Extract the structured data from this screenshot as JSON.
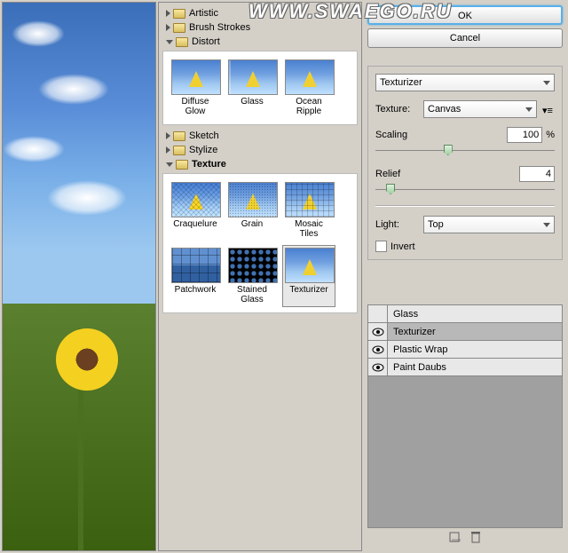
{
  "watermark": "WWW.SWAEGO.RU",
  "buttons": {
    "ok": "OK",
    "cancel": "Cancel"
  },
  "filter_select": "Texturizer",
  "categories": [
    {
      "name": "Artistic",
      "open": false
    },
    {
      "name": "Brush Strokes",
      "open": false
    },
    {
      "name": "Distort",
      "open": true,
      "items": [
        "Diffuse Glow",
        "Glass",
        "Ocean Ripple"
      ]
    },
    {
      "name": "Sketch",
      "open": false
    },
    {
      "name": "Stylize",
      "open": false
    },
    {
      "name": "Texture",
      "open": true,
      "bold": true,
      "items": [
        "Craquelure",
        "Grain",
        "Mosaic Tiles",
        "Patchwork",
        "Stained Glass",
        "Texturizer"
      ],
      "selected": "Texturizer"
    }
  ],
  "params": {
    "texture_label": "Texture:",
    "texture_value": "Canvas",
    "scaling_label": "Scaling",
    "scaling_value": "100",
    "scaling_pct": "%",
    "relief_label": "Relief",
    "relief_value": "4",
    "light_label": "Light:",
    "light_value": "Top",
    "invert_label": "Invert"
  },
  "stack": [
    {
      "name": "Glass",
      "visible": false
    },
    {
      "name": "Texturizer",
      "visible": true,
      "selected": true
    },
    {
      "name": "Plastic Wrap",
      "visible": true
    },
    {
      "name": "Paint Daubs",
      "visible": true
    }
  ],
  "icons": {
    "new_layer": "new-effect-layer-icon",
    "trash": "delete-effect-layer-icon"
  }
}
